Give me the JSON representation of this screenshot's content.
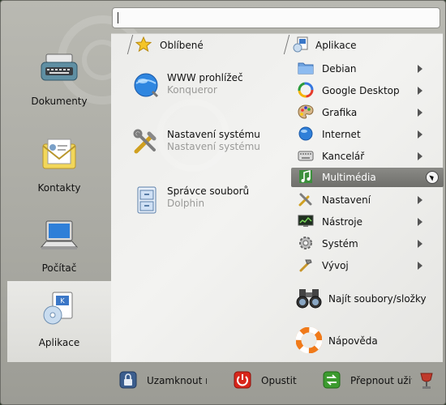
{
  "search": {
    "value": "",
    "placeholder": ""
  },
  "sidebar": {
    "items": [
      {
        "label": "Dokumenty",
        "icon": "typewriter-icon"
      },
      {
        "label": "Kontakty",
        "icon": "contacts-icon"
      },
      {
        "label": "Počítač",
        "icon": "laptop-icon"
      },
      {
        "label": "Aplikace",
        "icon": "applications-icon",
        "active": true
      }
    ]
  },
  "favorites": {
    "header": "Oblíbené",
    "items": [
      {
        "title": "WWW prohlížeč",
        "subtitle": "Konqueror",
        "icon": "globe-icon"
      },
      {
        "title": "Nastavení systému",
        "subtitle": "Nastavení systému",
        "icon": "tools-icon"
      },
      {
        "title": "Správce souborů",
        "subtitle": "Dolphin",
        "icon": "file-cabinet-icon"
      }
    ]
  },
  "applications": {
    "header": "Aplikace",
    "items": [
      {
        "label": "Debian",
        "icon": "folder-icon"
      },
      {
        "label": "Google Desktop",
        "icon": "google-desktop-icon"
      },
      {
        "label": "Grafika",
        "icon": "palette-icon"
      },
      {
        "label": "Internet",
        "icon": "globe-icon"
      },
      {
        "label": "Kancelář",
        "icon": "keyboard-icon"
      },
      {
        "label": "Multimédia",
        "icon": "music-icon",
        "selected": true
      },
      {
        "label": "Nastavení",
        "icon": "tools-icon"
      },
      {
        "label": "Nástroje",
        "icon": "monitor-icon"
      },
      {
        "label": "Systém",
        "icon": "gear-icon"
      },
      {
        "label": "Vývoj",
        "icon": "hammer-icon"
      }
    ],
    "extras": [
      {
        "label": "Najít soubory/složky",
        "icon": "binoculars-icon"
      },
      {
        "label": "Nápověda",
        "icon": "lifebuoy-icon"
      }
    ]
  },
  "bottom_bar": {
    "lock": "Uzamknout re",
    "logout": "Opustit",
    "switch_user": "Přepnout uživ"
  },
  "colors": {
    "menu_bg": "#b0b0a9",
    "panel_bg": "#efefec",
    "selected": "#7a7a76",
    "logout_red": "#d8261b",
    "switch_green": "#3c9b2f"
  }
}
